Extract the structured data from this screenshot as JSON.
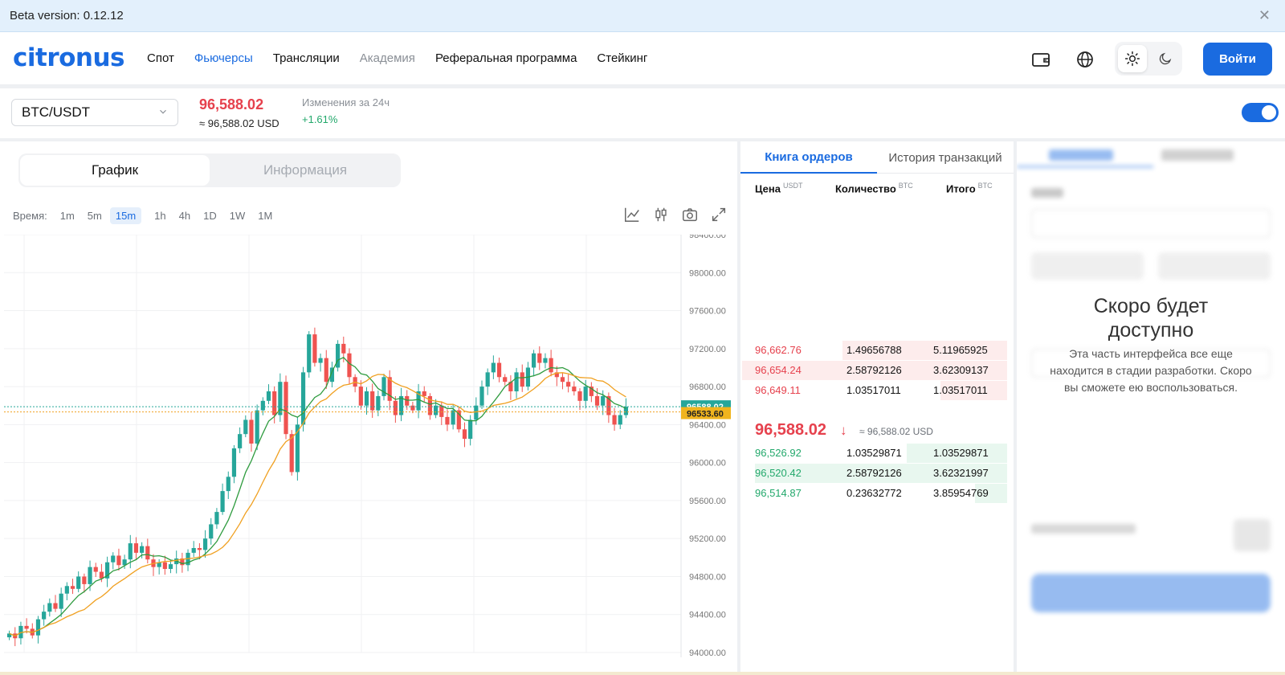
{
  "beta": {
    "text": "Beta version: 0.12.12"
  },
  "header": {
    "logo": "citronus",
    "nav": [
      "Спот",
      "Фьючерсы",
      "Трансляции",
      "Академия",
      "Реферальная программа",
      "Стейкинг"
    ],
    "login": "Войти"
  },
  "ticker": {
    "pair": "BTC/USDT",
    "price": "96,588.02",
    "price_usd": "≈ 96,588.02 USD",
    "change_label": "Изменения за 24ч",
    "change_value": "+1.61%"
  },
  "chart": {
    "tabs": {
      "chart": "График",
      "info": "Информация"
    },
    "time_label": "Время:",
    "timeframes": [
      "1m",
      "5m",
      "15m",
      "1h",
      "4h",
      "1D",
      "1W",
      "1M"
    ],
    "active_timeframe": "15m",
    "colors": {
      "up": "#26a69a",
      "down": "#ef5350",
      "ma_fast": "#2e9b3e",
      "ma_slow": "#f0a020"
    }
  },
  "chart_data": {
    "type": "candlestick",
    "y_ticks": [
      "98400.00",
      "98000.00",
      "97600.00",
      "97200.00",
      "96800.00",
      "96400.00",
      "96000.00",
      "95600.00",
      "95200.00",
      "94800.00",
      "94400.00",
      "94000.00"
    ],
    "ylim": [
      94000,
      98400
    ],
    "last_price_label": "96588.02",
    "ma_label": "96533.60",
    "close_series": [
      94200,
      94150,
      94280,
      94250,
      94180,
      94350,
      94430,
      94520,
      94460,
      94620,
      94700,
      94670,
      94800,
      94720,
      94900,
      94850,
      94780,
      94950,
      95020,
      94920,
      94980,
      95150,
      95050,
      95120,
      94980,
      94900,
      94950,
      94880,
      94930,
      94990,
      94920,
      95050,
      95100,
      95080,
      95200,
      95350,
      95480,
      95700,
      95850,
      96150,
      96300,
      96450,
      96200,
      96550,
      96650,
      96750,
      96500,
      96850,
      96300,
      95900,
      96400,
      96950,
      97350,
      97050,
      97100,
      96850,
      97000,
      97250,
      97150,
      96900,
      96800,
      96600,
      96750,
      96550,
      96700,
      96900,
      96650,
      96500,
      96700,
      96600,
      96550,
      96750,
      96700,
      96500,
      96600,
      96480,
      96400,
      96550,
      96350,
      96250,
      96450,
      96600,
      96800,
      96950,
      97050,
      96900,
      96850,
      96750,
      96950,
      96800,
      97000,
      97150,
      97050,
      97100,
      96950,
      96900,
      96850,
      96800,
      96750,
      96650,
      96800,
      96700,
      96600,
      96700,
      96500,
      96400,
      96500,
      96588
    ]
  },
  "orderbook": {
    "tabs": [
      "Книга ордеров",
      "История транзакций"
    ],
    "headers": [
      {
        "label": "Цена",
        "unit": "USDT"
      },
      {
        "label": "Количество",
        "unit": "BTC"
      },
      {
        "label": "Итого",
        "unit": "BTC"
      }
    ],
    "asks": [
      {
        "price": "96,662.76",
        "qty": "1.49656788",
        "total": "5.11965925",
        "depth": 0.62
      },
      {
        "price": "96,654.24",
        "qty": "2.58792126",
        "total": "3.62309137",
        "depth": 1.0
      },
      {
        "price": "96,649.11",
        "qty": "1.03517011",
        "total": "1.03517011",
        "depth": 0.25
      }
    ],
    "mid": {
      "price": "96,588.02",
      "usd": "≈ 96,588.02 USD"
    },
    "bids": [
      {
        "price": "96,526.92",
        "qty": "1.03529871",
        "total": "1.03529871",
        "depth": 0.38
      },
      {
        "price": "96,520.42",
        "qty": "2.58792126",
        "total": "3.62321997",
        "depth": 0.95
      },
      {
        "price": "96,514.87",
        "qty": "0.23632772",
        "total": "3.85954769",
        "depth": 0.12
      }
    ]
  },
  "trade": {
    "soon_title": "Скоро будет доступно",
    "soon_text": "Эта часть интерфейса все еще находится в стадии разработки. Скоро вы сможете ею воспользоваться."
  }
}
